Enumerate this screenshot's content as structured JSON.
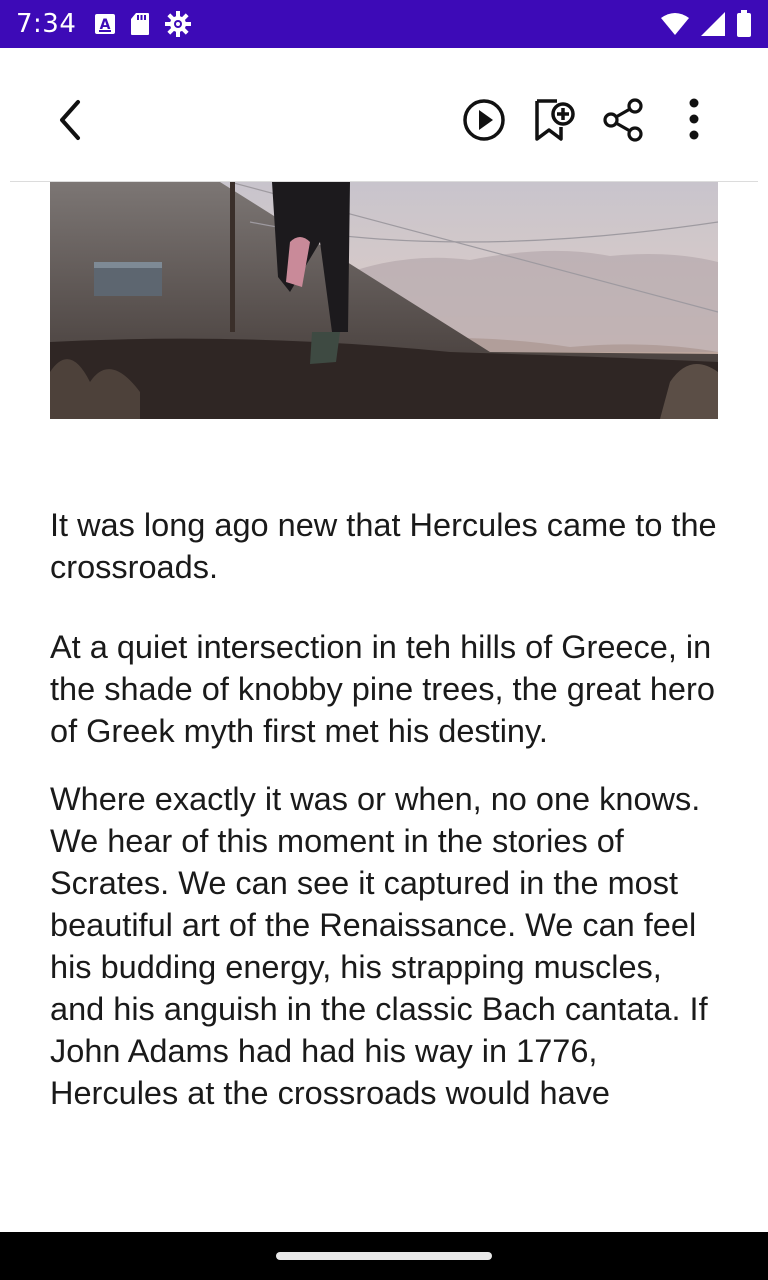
{
  "status_bar": {
    "time": "7:34",
    "left_icons": [
      "text-a-icon",
      "sd-card-icon",
      "settings-gear-icon"
    ],
    "right_icons": [
      "wifi-icon",
      "cellular-signal-icon",
      "battery-icon"
    ],
    "background": "#3d0ab7"
  },
  "toolbar": {
    "back_icon": "chevron-left-icon",
    "actions": [
      "play-icon",
      "bookmark-add-icon",
      "share-icon",
      "more-vert-icon"
    ]
  },
  "article": {
    "hero_image": "runner-on-hillside-photo",
    "paragraphs": [
      "It was long ago new that Hercules came to the crossroads.",
      "At a quiet intersection in teh hills of Greece, in the shade of knobby pine trees, the great hero of Greek myth first met his destiny.",
      "Where exactly it was or when, no one knows. We hear of this moment in the stories of Scrates. We can see it captured in the most beautiful art of the Renaissance. We can feel his budding energy, his strapping muscles, and his anguish in the classic Bach cantata. If John Adams had had his way in 1776, Hercules at the crossroads would have"
    ]
  },
  "colors": {
    "accent": "#3d0ab7",
    "text": "#1a1a1a",
    "icon": "#111111"
  }
}
